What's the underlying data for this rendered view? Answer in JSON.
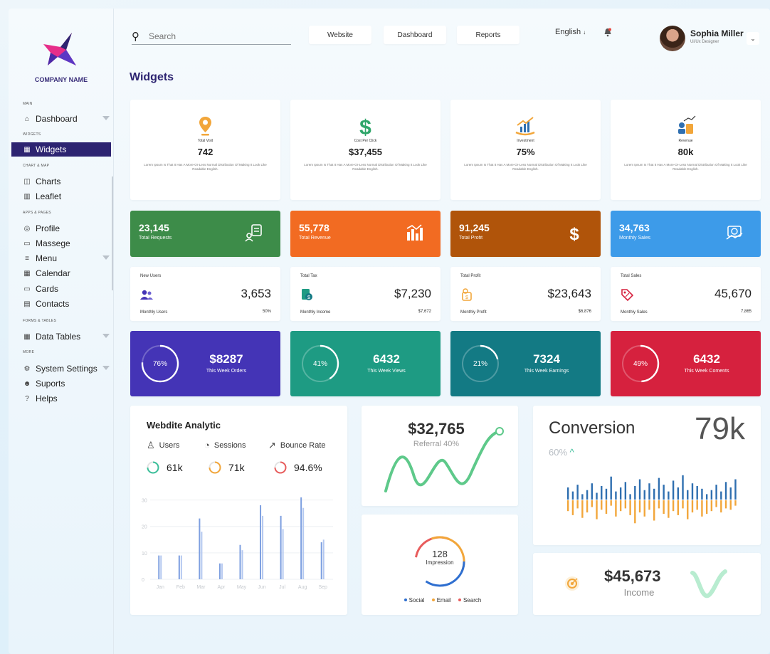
{
  "app": {
    "company_name": "COMPANY NAME",
    "page_title": "Widgets"
  },
  "sidebar": {
    "sections": {
      "main": "MAIN",
      "widgets": "WIDGETS",
      "chart_map": "CHART & MAP",
      "apps_pages": "Apps & Pages",
      "forms_tables": "FORMS & TABLES",
      "more": "More"
    },
    "items": [
      {
        "label": "Dashboard",
        "icon": "home-icon"
      },
      {
        "label": "Widgets",
        "icon": "grid-icon"
      },
      {
        "label": "Charts",
        "icon": "chart-icon"
      },
      {
        "label": "Leaflet",
        "icon": "map-icon"
      },
      {
        "label": "Profile",
        "icon": "user-icon"
      },
      {
        "label": "Massege",
        "icon": "message-icon"
      },
      {
        "label": "Menu",
        "icon": "menu-icon"
      },
      {
        "label": "Calendar",
        "icon": "calendar-icon"
      },
      {
        "label": "Cards",
        "icon": "card-icon"
      },
      {
        "label": "Contacts",
        "icon": "contacts-icon"
      },
      {
        "label": "Data Tables",
        "icon": "table-icon"
      },
      {
        "label": "System Settings",
        "icon": "gear-icon"
      },
      {
        "label": "Suports",
        "icon": "support-icon"
      },
      {
        "label": "Helps",
        "icon": "help-icon"
      }
    ]
  },
  "topbar": {
    "search_placeholder": "Search",
    "buttons": [
      "Website",
      "Dashboard",
      "Reports"
    ],
    "language": "English",
    "user_name": "Sophia Miller",
    "user_role": "Ui/Ux Designer"
  },
  "row1": [
    {
      "label": "Total Visit",
      "value": "742",
      "desc": "Lorem Ipsum Is That It Has A More-Or-Less Normal Distribution Of Making It Look Like Readable English.",
      "icon": "location-pin-icon"
    },
    {
      "label": "Cost Per Click",
      "value": "$37,455",
      "desc": "Lorem Ipsum Is That It Has A More-Or-Less Normal Distribution Of Making It Look Like Readable English.",
      "icon": "dollar-icon"
    },
    {
      "label": "Investment",
      "value": "75%",
      "desc": "Lorem Ipsum Is That It Has A More-Or-Less Normal Distribution Of Making It Look Like Readable English.",
      "icon": "investment-icon"
    },
    {
      "label": "Revenue",
      "value": "80k",
      "desc": "Lorem Ipsum Is That It Has A More-Or-Less Normal Distribution Of Making It Look Like Readable English.",
      "icon": "revenue-icon"
    }
  ],
  "row2": [
    {
      "value": "23,145",
      "label": "Total Requests",
      "color": "#3d8c49",
      "icon": "request-icon"
    },
    {
      "value": "55,778",
      "label": "Total Revenue",
      "color": "#f26b22",
      "icon": "bar-chart-icon"
    },
    {
      "value": "91,245",
      "label": "Total Profit",
      "color": "#b0540a",
      "icon": "dollar-icon"
    },
    {
      "value": "34,763",
      "label": "Monthly Sales",
      "color": "#3d9be9",
      "icon": "sales-icon"
    }
  ],
  "row3": [
    {
      "label": "New Users",
      "value": "3,653",
      "sub": "Monthly Users",
      "subv": "50%",
      "icon": "users-icon"
    },
    {
      "label": "Total Tax",
      "value": "$7,230",
      "sub": "Monthly Income",
      "subv": "$7,672",
      "icon": "tax-icon"
    },
    {
      "label": "Total Profit",
      "value": "$23,643",
      "sub": "Monthly Profit",
      "subv": "$6,876",
      "icon": "profit-icon"
    },
    {
      "label": "Total Sales",
      "value": "45,670",
      "sub": "Monthly Sales",
      "subv": "7,865",
      "icon": "tag-icon"
    }
  ],
  "row4": [
    {
      "pct": "76%",
      "value": "$8287",
      "label": "This Week Orders",
      "color": "#4434b6",
      "fraction": 0.76
    },
    {
      "pct": "41%",
      "value": "6432",
      "label": "This Week Views",
      "color": "#1e9b83",
      "fraction": 0.41
    },
    {
      "pct": "21%",
      "value": "7324",
      "label": "This Week Earnings",
      "color": "#137a84",
      "fraction": 0.21
    },
    {
      "pct": "49%",
      "value": "6432",
      "label": "This Week Coments",
      "color": "#d6213e",
      "fraction": 0.49
    }
  ],
  "analytics": {
    "title": "Webdite Analytic",
    "legend": [
      "Users",
      "Sessions",
      "Bounce Rate"
    ],
    "stats": [
      {
        "value": "61k",
        "color": "#3bbf9a"
      },
      {
        "value": "71k",
        "color": "#f2a63a"
      },
      {
        "value": "94.6%",
        "color": "#e85c5c"
      }
    ]
  },
  "chart_data": {
    "type": "bar",
    "categories": [
      "Jan",
      "Feb",
      "Mar",
      "Apr",
      "May",
      "Jun",
      "Jul",
      "Aug",
      "Sep"
    ],
    "series": [
      {
        "values": [
          9,
          9,
          23,
          6,
          13,
          28,
          24,
          31,
          14
        ]
      },
      {
        "values": [
          9,
          9,
          18,
          6,
          11,
          24,
          19,
          27,
          15
        ]
      }
    ],
    "yticks": [
      "0",
      "10",
      "20",
      "30"
    ],
    "ylim": [
      0,
      35
    ]
  },
  "referral": {
    "value": "$32,765",
    "label": "Referral 40%"
  },
  "conversion": {
    "title": "Conversion",
    "big": "79k",
    "pct": "60%",
    "up_values": [
      0.45,
      0.3,
      0.55,
      0.2,
      0.35,
      0.6,
      0.25,
      0.5,
      0.4,
      0.85,
      0.3,
      0.45,
      0.65,
      0.2,
      0.5,
      0.75,
      0.35,
      0.6,
      0.4,
      0.8,
      0.55,
      0.3,
      0.7,
      0.45,
      0.9,
      0.35,
      0.6,
      0.5,
      0.4,
      0.2,
      0.35,
      0.55,
      0.3,
      0.65,
      0.45,
      0.75
    ],
    "down_values": [
      0.4,
      0.55,
      0.3,
      0.65,
      0.45,
      0.25,
      0.7,
      0.35,
      0.5,
      0.2,
      0.6,
      0.4,
      0.3,
      0.55,
      0.85,
      0.45,
      0.6,
      0.35,
      0.75,
      0.3,
      0.5,
      0.65,
      0.4,
      0.55,
      0.3,
      0.7,
      0.45,
      0.35,
      0.6,
      0.5,
      0.4,
      0.25,
      0.45,
      0.3,
      0.35,
      0.2
    ]
  },
  "impression": {
    "value": "128",
    "label": "Impression",
    "legend": [
      {
        "label": "Social",
        "color": "#2f6fd0"
      },
      {
        "label": "Email",
        "color": "#f2a63a"
      },
      {
        "label": "Search",
        "color": "#e85c5c"
      }
    ]
  },
  "income": {
    "value": "$45,673",
    "label": "Income"
  },
  "colors": {
    "accent": "#2d2471",
    "green": "#3bbf9a",
    "bar_blue": "#7d9fe0",
    "conv_blue": "#2f6fb0",
    "conv_orange": "#f2a63a"
  }
}
